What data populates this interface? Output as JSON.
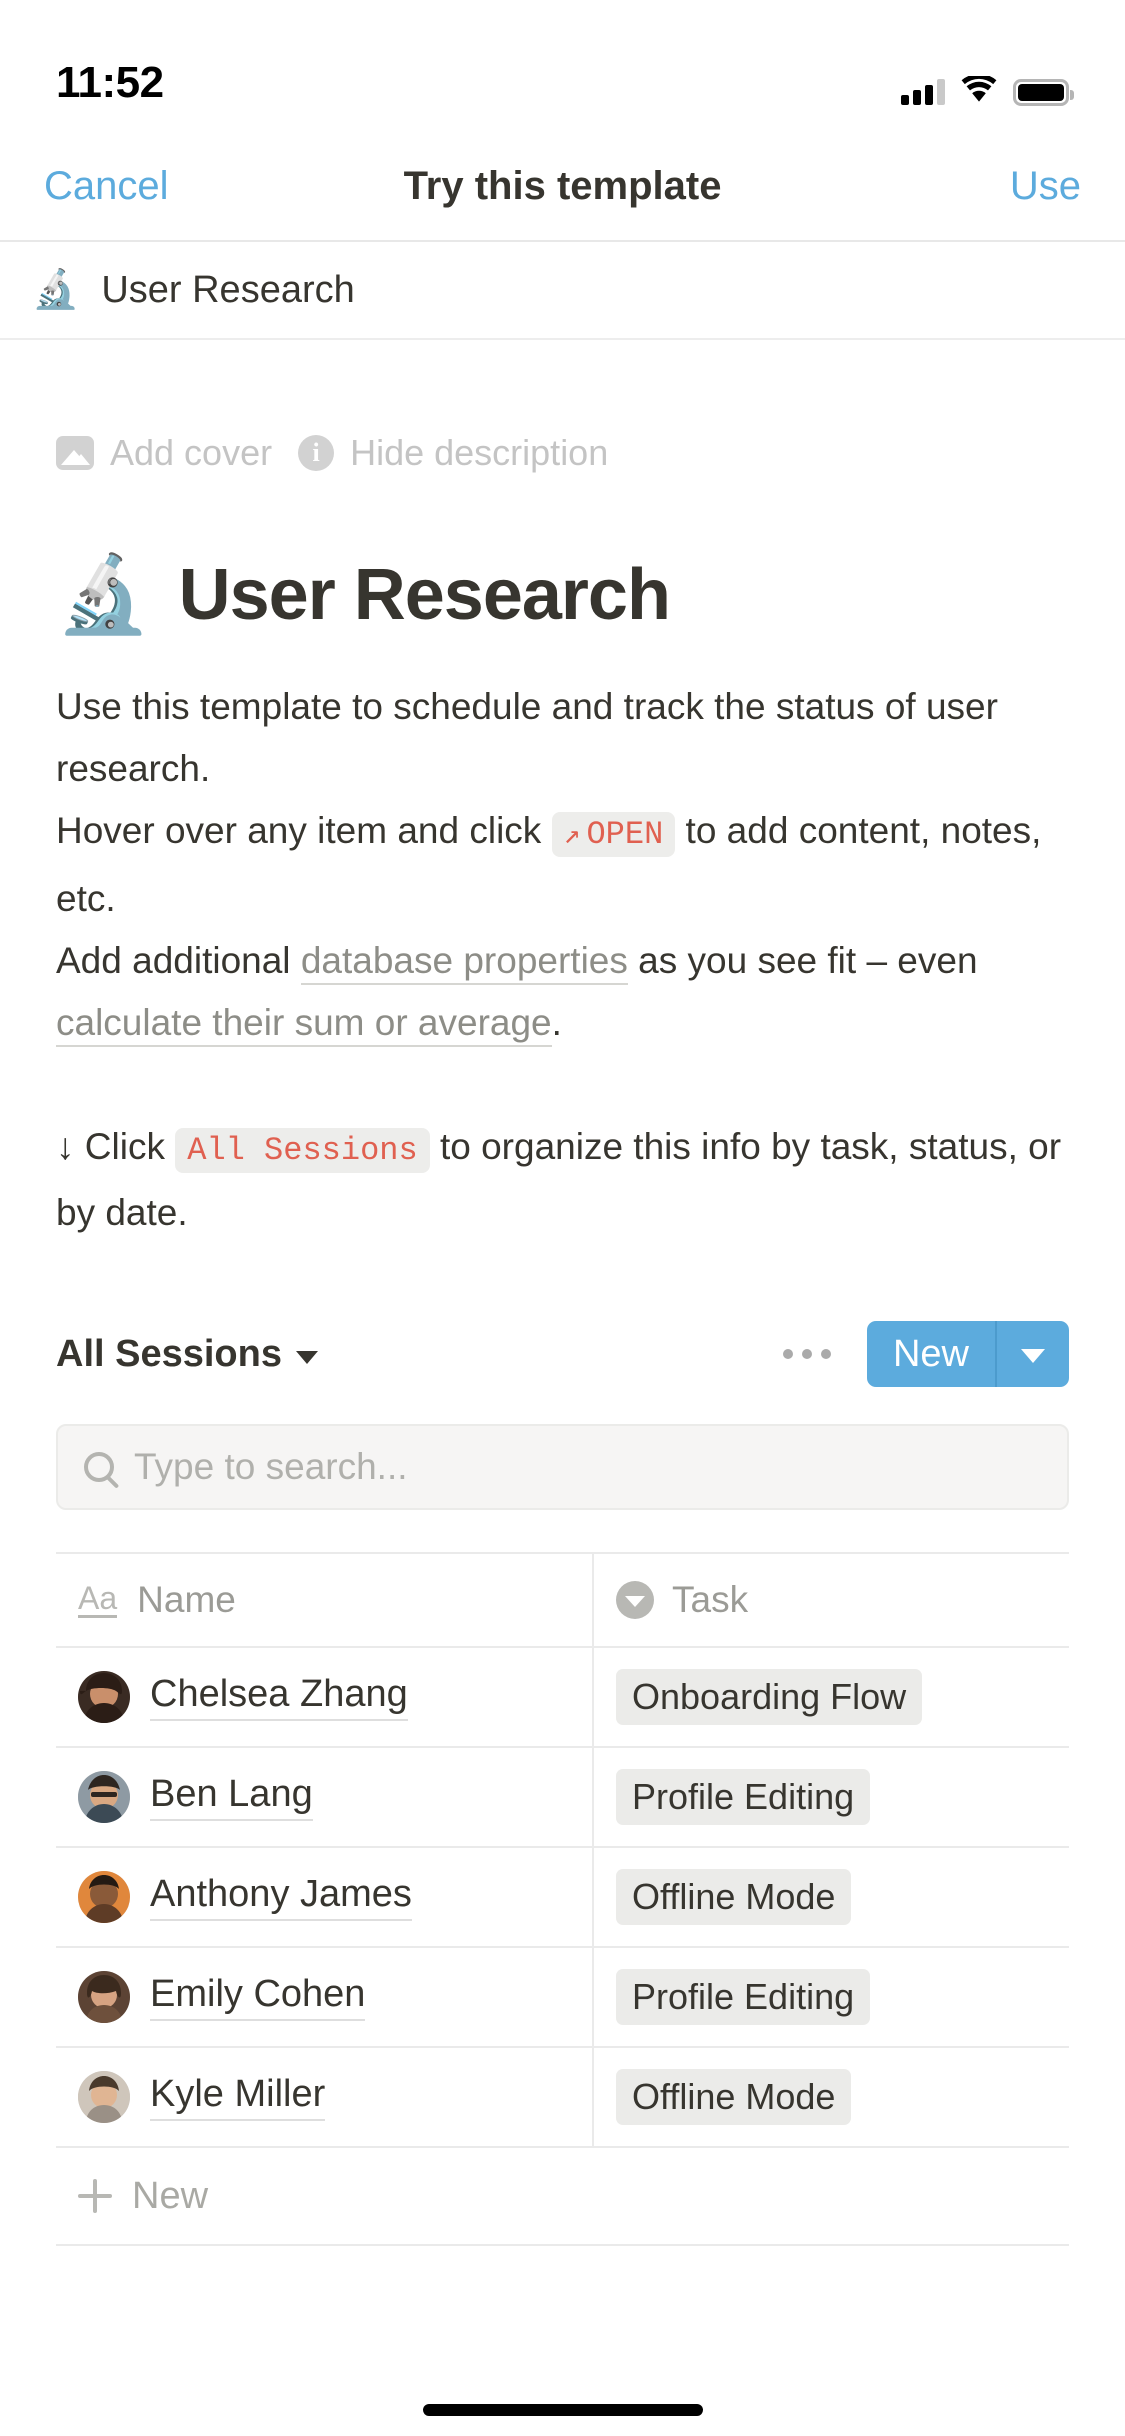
{
  "status_bar": {
    "time": "11:52",
    "cellular_icon": "signal-bars-icon",
    "wifi_icon": "wifi-icon",
    "battery_icon": "battery-icon"
  },
  "navbar": {
    "cancel_label": "Cancel",
    "title": "Try this template",
    "use_label": "Use"
  },
  "breadcrumb": {
    "emoji": "🔬",
    "label": "User Research"
  },
  "page_meta": {
    "add_cover_label": "Add cover",
    "hide_description_label": "Hide description",
    "image_icon": "image-icon",
    "info_icon": "info-icon"
  },
  "page_title": {
    "emoji": "🔬",
    "text": "User Research"
  },
  "description": {
    "line1": "Use this template to schedule and track the status of user research.",
    "line2_before": "Hover over any item and click",
    "open_chip_arrow": "↗",
    "open_chip_text": "OPEN",
    "line2_after": "to add content, notes, etc.",
    "line3_before": "Add additional",
    "link1": "database properties",
    "line3_mid": "as you see fit – even",
    "link2": "calculate their sum or average",
    "line3_after": ".",
    "line4_before": "↓ Click",
    "sessions_chip": "All Sessions",
    "line4_after": "to organize this info by task, status, or by date."
  },
  "view_bar": {
    "view_name": "All Sessions",
    "chevron_icon": "chevron-down-icon",
    "more_icon": "ellipsis-icon",
    "new_label": "New",
    "new_dropdown_icon": "chevron-down-icon",
    "accent_color": "#5CABDD"
  },
  "search": {
    "icon": "search-icon",
    "placeholder": "Type to search...",
    "value": ""
  },
  "table": {
    "columns": [
      {
        "label": "Name",
        "icon": "text-property-icon"
      },
      {
        "label": "Task",
        "icon": "select-property-icon"
      }
    ],
    "rows": [
      {
        "avatar": "avatar-chelsea",
        "name": "Chelsea Zhang",
        "task": "Onboarding Flow"
      },
      {
        "avatar": "avatar-ben",
        "name": "Ben Lang",
        "task": "Profile Editing"
      },
      {
        "avatar": "avatar-anthony",
        "name": "Anthony James",
        "task": "Offline Mode"
      },
      {
        "avatar": "avatar-emily",
        "name": "Emily Cohen",
        "task": "Profile Editing"
      },
      {
        "avatar": "avatar-kyle",
        "name": "Kyle Miller",
        "task": "Offline Mode"
      }
    ],
    "new_row_label": "New",
    "new_row_icon": "plus-icon"
  }
}
